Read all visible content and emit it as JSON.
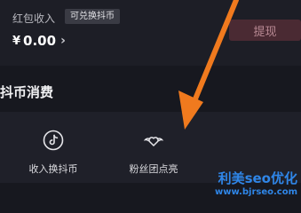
{
  "wallet": {
    "red_packet_label": "红包收入",
    "exchange_tag": "可兑换抖币",
    "currency": "¥",
    "amount": "0.00",
    "chevron": "›",
    "withdraw_label": "提现"
  },
  "section": {
    "title": "抖币消费"
  },
  "consume_items": [
    {
      "label": "收入换抖币",
      "icon": "tiktok-note-icon"
    },
    {
      "label": "粉丝团点亮",
      "icon": "winged-heart-icon"
    }
  ],
  "watermark": {
    "line1": "利美seo优化",
    "line2": "www.bjrseo.com"
  },
  "colors": {
    "arrow": "#f07a1e",
    "withdraw_bg": "#4a2a33",
    "watermark": "#2f86e8"
  }
}
